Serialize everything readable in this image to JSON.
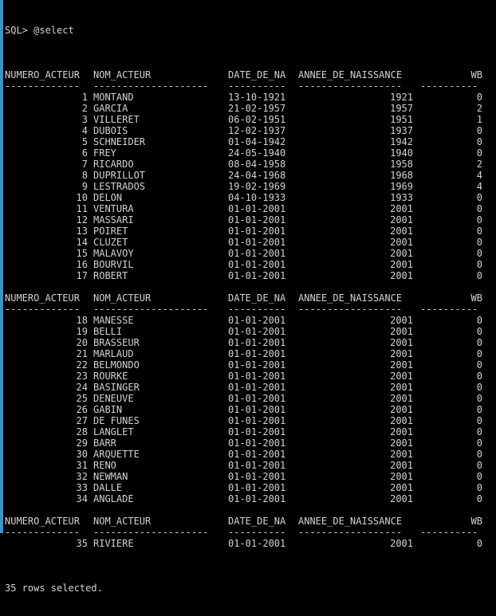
{
  "prompt_line": "SQL> @select",
  "headers": [
    "NUMERO_ACTEUR",
    "NOM_ACTEUR",
    "DATE_DE_NA",
    "ANNEE_DE_NAISSANCE",
    "WB"
  ],
  "separators": [
    "-------------",
    "--------------------",
    "----------",
    "------------------",
    "----------"
  ],
  "pages": [
    [
      [
        "1",
        "MONTAND",
        "13-10-1921",
        "1921",
        "0"
      ],
      [
        "2",
        "GARCIA",
        "21-02-1957",
        "1957",
        "2"
      ],
      [
        "3",
        "VILLERET",
        "06-02-1951",
        "1951",
        "1"
      ],
      [
        "4",
        "DUBOIS",
        "12-02-1937",
        "1937",
        "0"
      ],
      [
        "5",
        "SCHNEIDER",
        "01-04-1942",
        "1942",
        "0"
      ],
      [
        "6",
        "FREY",
        "24-05-1940",
        "1940",
        "0"
      ],
      [
        "7",
        "RICARDO",
        "08-04-1958",
        "1958",
        "2"
      ],
      [
        "8",
        "DUPRILLOT",
        "24-04-1968",
        "1968",
        "4"
      ],
      [
        "9",
        "LESTRADOS",
        "19-02-1969",
        "1969",
        "4"
      ],
      [
        "10",
        "DELON",
        "04-10-1933",
        "1933",
        "0"
      ],
      [
        "11",
        "VENTURA",
        "01-01-2001",
        "2001",
        "0"
      ],
      [
        "12",
        "MASSARI",
        "01-01-2001",
        "2001",
        "0"
      ],
      [
        "13",
        "POIRET",
        "01-01-2001",
        "2001",
        "0"
      ],
      [
        "14",
        "CLUZET",
        "01-01-2001",
        "2001",
        "0"
      ],
      [
        "15",
        "MALAVOY",
        "01-01-2001",
        "2001",
        "0"
      ],
      [
        "16",
        "BOURVIL",
        "01-01-2001",
        "2001",
        "0"
      ],
      [
        "17",
        "ROBERT",
        "01-01-2001",
        "2001",
        "0"
      ]
    ],
    [
      [
        "18",
        "MANESSE",
        "01-01-2001",
        "2001",
        "0"
      ],
      [
        "19",
        "BELLI",
        "01-01-2001",
        "2001",
        "0"
      ],
      [
        "20",
        "BRASSEUR",
        "01-01-2001",
        "2001",
        "0"
      ],
      [
        "21",
        "MARLAUD",
        "01-01-2001",
        "2001",
        "0"
      ],
      [
        "22",
        "BELMONDO",
        "01-01-2001",
        "2001",
        "0"
      ],
      [
        "23",
        "ROURKE",
        "01-01-2001",
        "2001",
        "0"
      ],
      [
        "24",
        "BASINGER",
        "01-01-2001",
        "2001",
        "0"
      ],
      [
        "25",
        "DENEUVE",
        "01-01-2001",
        "2001",
        "0"
      ],
      [
        "26",
        "GABIN",
        "01-01-2001",
        "2001",
        "0"
      ],
      [
        "27",
        "DE FUNES",
        "01-01-2001",
        "2001",
        "0"
      ],
      [
        "28",
        "LANGLET",
        "01-01-2001",
        "2001",
        "0"
      ],
      [
        "29",
        "BARR",
        "01-01-2001",
        "2001",
        "0"
      ],
      [
        "30",
        "ARQUETTE",
        "01-01-2001",
        "2001",
        "0"
      ],
      [
        "31",
        "RENO",
        "01-01-2001",
        "2001",
        "0"
      ],
      [
        "32",
        "NEWMAN",
        "01-01-2001",
        "2001",
        "0"
      ],
      [
        "33",
        "DALLE",
        "01-01-2001",
        "2001",
        "0"
      ],
      [
        "34",
        "ANGLADE",
        "01-01-2001",
        "2001",
        "0"
      ]
    ],
    [
      [
        "35",
        "RIVIERE",
        "01-01-2001",
        "2001",
        "0"
      ]
    ]
  ],
  "footer": "35 rows selected.",
  "colors": {
    "background": "#000000",
    "text": "#d2d2d2",
    "window_edge": "#3a93c9"
  }
}
